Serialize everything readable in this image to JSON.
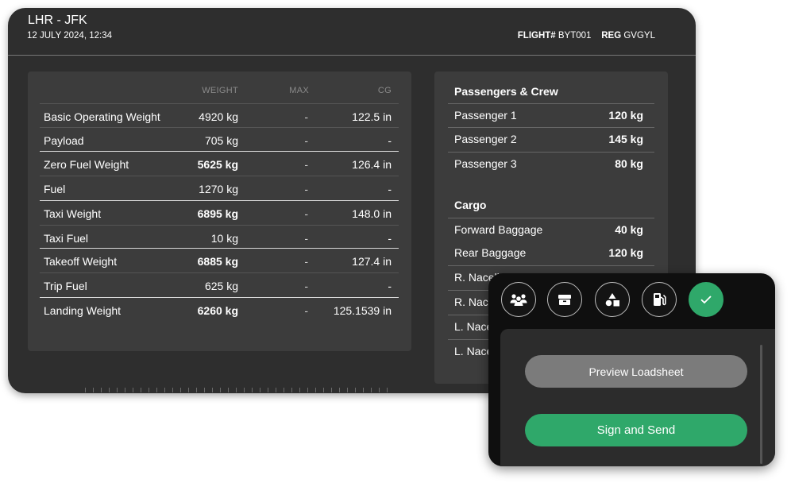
{
  "header": {
    "route": "LHR - JFK",
    "datetime": "12 JULY 2024, 12:34",
    "flight_label": "FLIGHT#",
    "flight_value": "BYT001",
    "reg_label": "REG",
    "reg_value": "GVGYL"
  },
  "weights": {
    "columns": {
      "weight": "WEIGHT",
      "max": "MAX",
      "cg": "CG"
    },
    "rows": [
      {
        "label": "Basic Operating Weight",
        "weight": "4920 kg",
        "max": "-",
        "cg": "122.5 in"
      },
      {
        "label": "Payload",
        "weight": "705 kg",
        "max": "-",
        "cg": "-"
      },
      {
        "label": "Zero Fuel Weight",
        "weight": "5625 kg",
        "max": "-",
        "cg": "126.4 in"
      },
      {
        "label": "Fuel",
        "weight": "1270 kg",
        "max": "-",
        "cg": "-"
      },
      {
        "label": "Taxi Weight",
        "weight": "6895 kg",
        "max": "-",
        "cg": "148.0 in"
      },
      {
        "label": "Taxi Fuel",
        "weight": "10 kg",
        "max": "-",
        "cg": "-"
      },
      {
        "label": "Takeoff Weight",
        "weight": "6885 kg",
        "max": "-",
        "cg": "127.4 in"
      },
      {
        "label": "Trip Fuel",
        "weight": "625 kg",
        "max": "-",
        "cg": "-"
      },
      {
        "label": "Landing Weight",
        "weight": "6260 kg",
        "max": "-",
        "cg": "125.1539 in"
      }
    ]
  },
  "passengers": {
    "title": "Passengers & Crew",
    "items": [
      {
        "label": "Passenger 1",
        "value": "120 kg"
      },
      {
        "label": "Passenger 2",
        "value": "145 kg"
      },
      {
        "label": "Passenger 3",
        "value": "80 kg"
      }
    ]
  },
  "cargo": {
    "title": "Cargo",
    "items": [
      {
        "label": "Forward Baggage",
        "value": "40 kg"
      },
      {
        "label": "Rear Baggage",
        "value": "120 kg"
      },
      {
        "label": "R. Nacelle",
        "value": ""
      },
      {
        "label": "R. Nace",
        "value": ""
      },
      {
        "label": "L. Nace",
        "value": ""
      },
      {
        "label": "L. Nace",
        "value": ""
      }
    ]
  },
  "popup": {
    "icons": [
      "people-icon",
      "box-icon",
      "shapes-icon",
      "fuel-icon",
      "check-icon"
    ],
    "active_icon": "check-icon",
    "preview_label": "Preview Loadsheet",
    "send_label": "Sign and Send"
  },
  "colors": {
    "accent": "#2fa86a",
    "panel": "#2e2e2e",
    "card": "#3c3c3c"
  }
}
